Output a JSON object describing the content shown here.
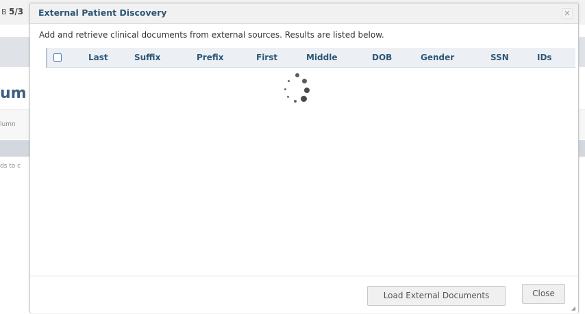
{
  "background": {
    "date_text": "5/3",
    "date_prefix": "B",
    "heading_fragment": "um",
    "column_fragment": "lumn",
    "fields_fragment": "ds to c"
  },
  "dialog": {
    "title": "External Patient Discovery",
    "close_icon": "×",
    "description": "Add and retrieve clinical documents from external sources. Results are listed below.",
    "columns": [
      "Last",
      "Suffix",
      "Prefix",
      "First",
      "Middle",
      "DOB",
      "Gender",
      "SSN",
      "IDs"
    ],
    "loading": true,
    "buttons": {
      "load_external": "Load External Documents",
      "close": "Close"
    }
  },
  "colors": {
    "title_text": "#2d5777",
    "header_bg": "#ecf0f4",
    "checkbox_border": "#4a7fbf"
  },
  "icons": {
    "spinner": "loading-spinner-icon",
    "close": "close-icon",
    "resize": "resize-grip-icon"
  }
}
